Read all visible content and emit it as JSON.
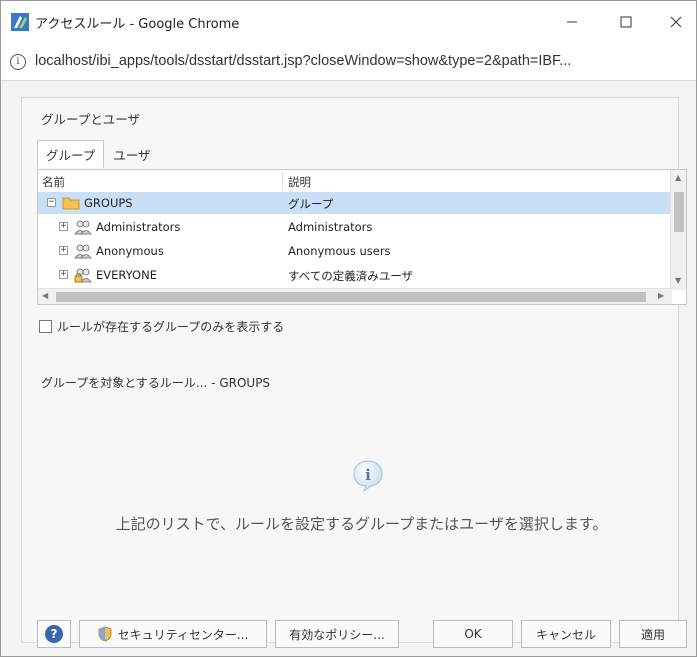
{
  "window": {
    "title": "アクセスルール - Google Chrome",
    "url": "localhost/ibi_apps/tools/dsstart/dsstart.jsp?closeWindow=show&type=2&path=IBF..."
  },
  "section_title": "グループとユーザ",
  "tabs": [
    {
      "label": "グループ",
      "active": true
    },
    {
      "label": "ユーザ",
      "active": false
    }
  ],
  "table": {
    "columns": {
      "name": "名前",
      "description": "説明"
    },
    "rows": [
      {
        "name": "GROUPS",
        "description": "グループ",
        "icon": "folder-icon",
        "expander": "−",
        "selected": true
      },
      {
        "name": "Administrators",
        "description": "Administrators",
        "icon": "group-icon",
        "expander": "+",
        "selected": false
      },
      {
        "name": "Anonymous",
        "description": "Anonymous users",
        "icon": "group-icon",
        "expander": "+",
        "selected": false
      },
      {
        "name": "EVERYONE",
        "description": "すべての定義済みユーザ",
        "icon": "locked-group-icon",
        "expander": "+",
        "selected": false
      }
    ]
  },
  "checkbox_label": "ルールが存在するグループのみを表示する",
  "rules_title": "グループを対象とするルール... - GROUPS",
  "hint": "上記のリストで、ルールを設定するグループまたはユーザを選択します。",
  "buttons": {
    "help": "?",
    "security_center": "セキュリティセンター...",
    "effective_policy": "有効なポリシー...",
    "ok": "OK",
    "cancel": "キャンセル",
    "apply": "適用"
  },
  "colors": {
    "selected_row": "#c8dff6",
    "folder": "#f2c14e",
    "help_button": "#3b66b3"
  }
}
